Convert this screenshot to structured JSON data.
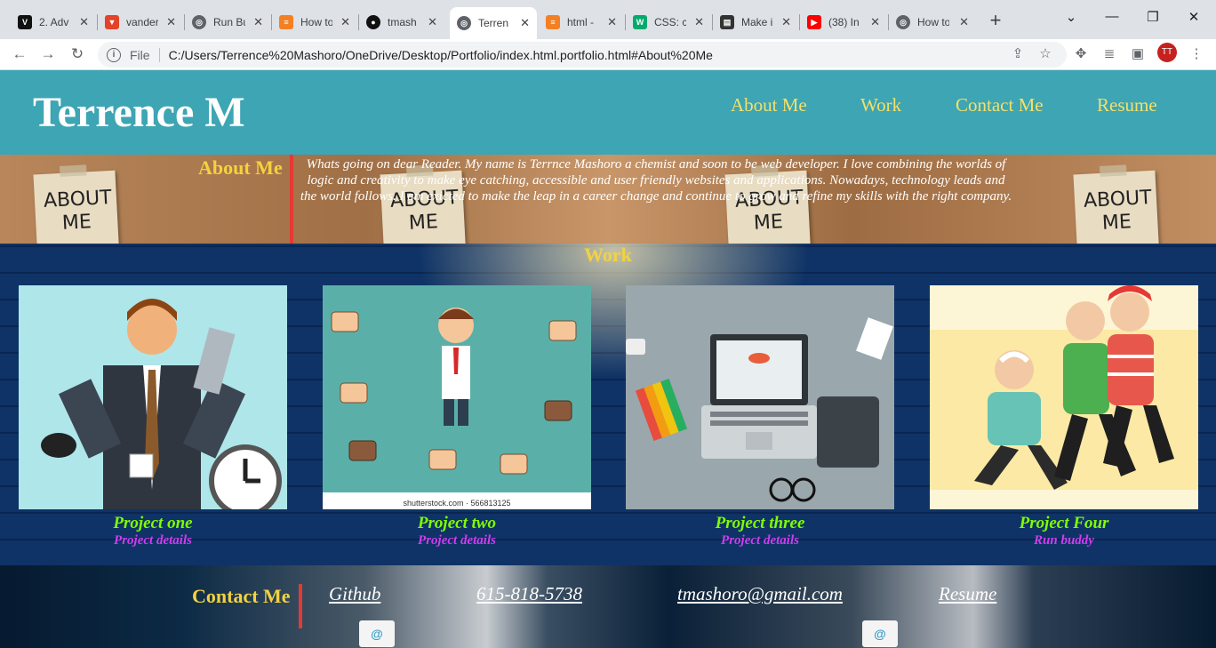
{
  "browser": {
    "tabs": [
      {
        "title": "2. Adv",
        "favicon": "vanderbilt-logo-icon",
        "color": "#111111"
      },
      {
        "title": "vander",
        "favicon": "gitlab-icon",
        "color": "#e24329"
      },
      {
        "title": "Run Bu",
        "favicon": "globe-icon",
        "color": "#5f6368"
      },
      {
        "title": "How to",
        "favicon": "stackoverflow-icon",
        "color": "#f48024"
      },
      {
        "title": "tmash",
        "favicon": "github-icon",
        "color": "#111111"
      },
      {
        "title": "Terren",
        "favicon": "globe-icon",
        "color": "#5f6368",
        "active": true
      },
      {
        "title": "html -",
        "favicon": "stackoverflow-icon",
        "color": "#f48024"
      },
      {
        "title": "CSS: cc",
        "favicon": "w3schools-icon",
        "color": "#04aa6d"
      },
      {
        "title": "Make i",
        "favicon": "document-icon",
        "color": "#333333"
      },
      {
        "title": "(38) In",
        "favicon": "youtube-icon",
        "color": "#ff0000"
      },
      {
        "title": "How to",
        "favicon": "globe-icon",
        "color": "#5f6368"
      }
    ],
    "address": {
      "scheme_label": "File",
      "url": "C:/Users/Terrence%20Mashoro/OneDrive/Desktop/Portfolio/index.html.portfolio.html#About%20Me"
    },
    "profile_initials": "TT"
  },
  "site": {
    "logo": "Terrence M",
    "nav": [
      "About Me",
      "Work",
      "Contact Me",
      "Resume"
    ],
    "about": {
      "heading": "About Me",
      "note_text": "ABOUT ME",
      "text": "Whats going on dear Reader. My name is Terrnce Mashoro a chemist and soon to be web developer. I love combining the worlds of logic and creativity to make eye catching, accessible and user friendly websites and applications. Nowadays, technology leads and the world follows. I am exicted to make the leap in a career change and continue to grow and refine my skills with the right company."
    },
    "work": {
      "heading": "Work",
      "projects": [
        {
          "title": "Project one",
          "details": "Project details"
        },
        {
          "title": "Project two",
          "details": "Project details",
          "image_caption": "shutterstock.com · 566813125"
        },
        {
          "title": "Project three",
          "details": "Project details"
        },
        {
          "title": "Project Four",
          "details": "Run buddy"
        }
      ]
    },
    "contact": {
      "heading": "Contact Me",
      "links": [
        "Github",
        "615-818-5738",
        "tmashoro@gmail.com",
        "Resume"
      ]
    }
  },
  "colors": {
    "header_bg": "#3da5b3",
    "nav_link": "#f3e06b",
    "section_heading": "#f3d23f",
    "accent_bar": "#e53935",
    "project_title": "#7fff00",
    "project_details": "#d03df0"
  }
}
